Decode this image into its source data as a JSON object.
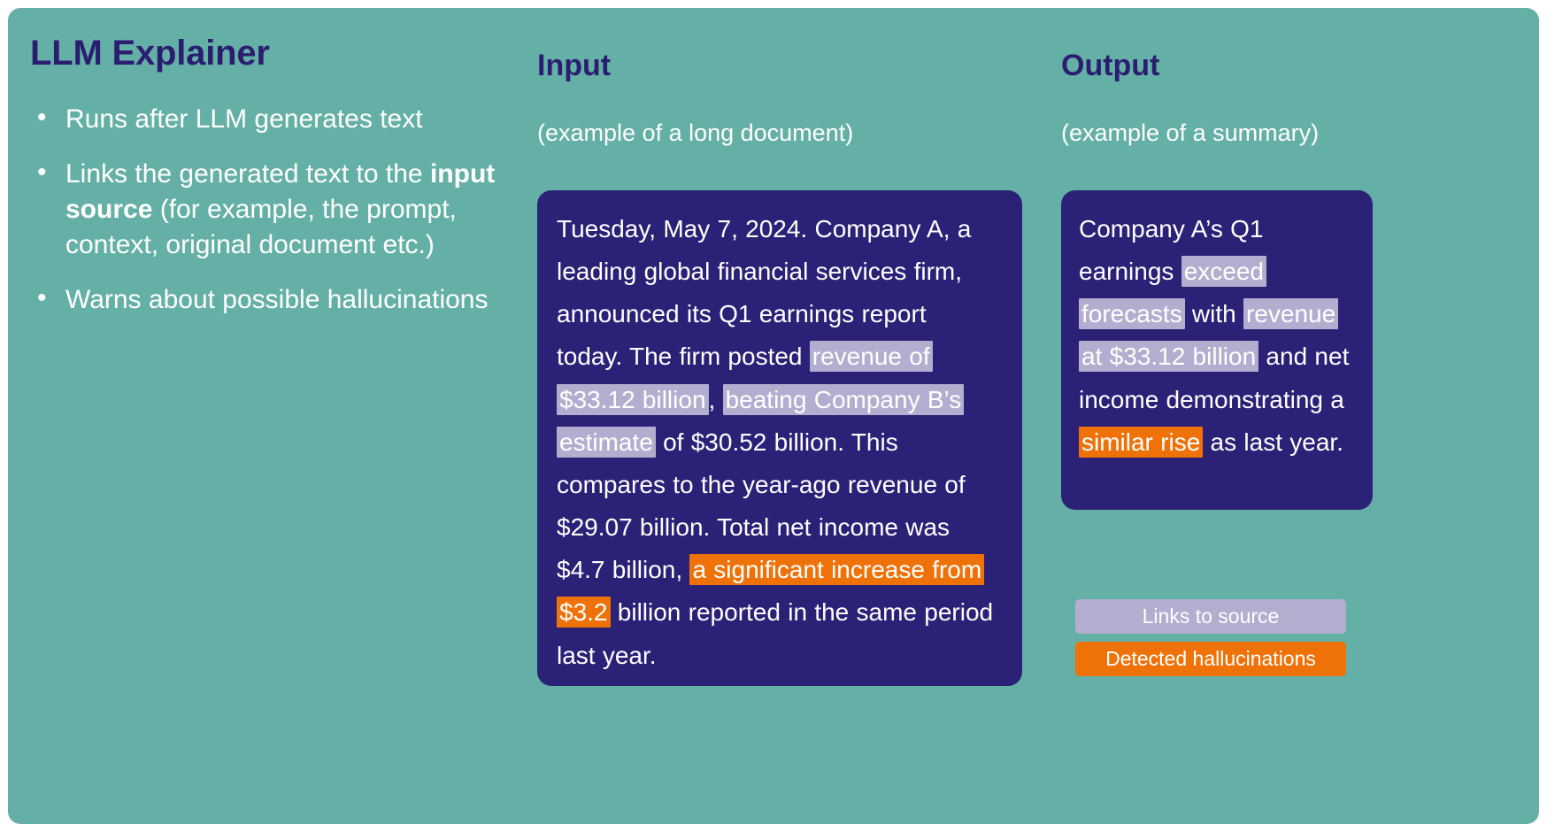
{
  "slide": {
    "background_color": "#65b0a6",
    "accent_navy": "#2b1e71",
    "card_navy": "#2b2177",
    "source_highlight_color": "#b3aecf",
    "hallucination_highlight_color": "#ef7209"
  },
  "explainer": {
    "title": "LLM Explainer",
    "bullets": [
      {
        "prefix": "Runs after LLM generates text",
        "bold": "",
        "suffix": ""
      },
      {
        "prefix": "Links the generated text to the ",
        "bold": "input source",
        "suffix": " (for example, the prompt, context, original document etc.)"
      },
      {
        "prefix": "Warns about possible hallucinations",
        "bold": "",
        "suffix": ""
      }
    ]
  },
  "input_column": {
    "heading": "Input",
    "subheading": "(example of a long document)",
    "document_segments": [
      {
        "text": "Tuesday, May 7, 2024. Company A, a leading global financial services firm, announced its Q1 earnings report today. The firm posted ",
        "style": "plain"
      },
      {
        "text": "revenue of $33.12 billion",
        "style": "source"
      },
      {
        "text": ", ",
        "style": "plain"
      },
      {
        "text": "beating Company B’s estimate",
        "style": "source"
      },
      {
        "text": " of $30.52 billion. This compares to the year-ago revenue of $29.07 billion. Total net income was $4.7 billion, ",
        "style": "plain"
      },
      {
        "text": "a significant increase from $3.2",
        "style": "hallucination"
      },
      {
        "text": " billion reported in the same period last year.",
        "style": "plain"
      }
    ]
  },
  "output_column": {
    "heading": "Output",
    "subheading": "(example of a summary)",
    "summary_segments": [
      {
        "text": "Company A’s Q1 earnings ",
        "style": "plain"
      },
      {
        "text": "exceed forecasts",
        "style": "source"
      },
      {
        "text": " with ",
        "style": "plain"
      },
      {
        "text": "revenue at $33.12 billion",
        "style": "source"
      },
      {
        "text": " and net income demonstrating a ",
        "style": "plain"
      },
      {
        "text": "similar rise",
        "style": "hallucination"
      },
      {
        "text": " as last year.",
        "style": "plain"
      }
    ]
  },
  "legend": {
    "items": [
      {
        "label": "Links to source",
        "color": "#b3aecf"
      },
      {
        "label": "Detected hallucinations",
        "color": "#ef7209"
      }
    ]
  }
}
